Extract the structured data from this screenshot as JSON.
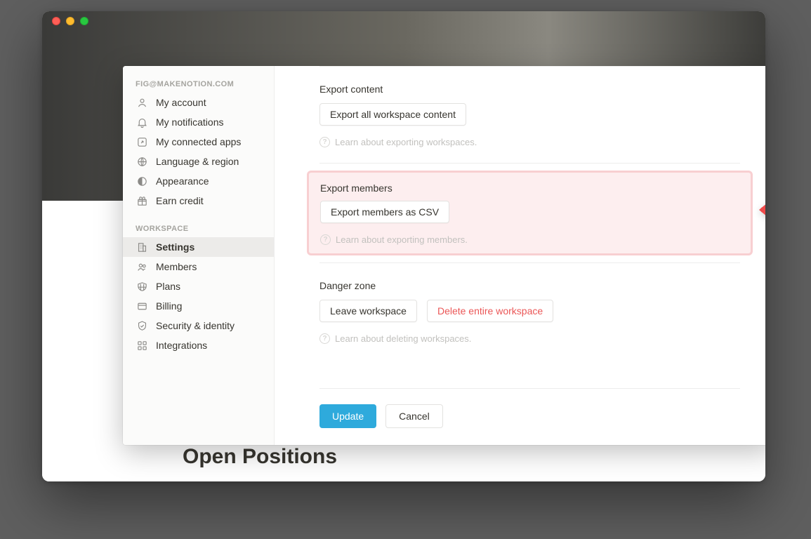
{
  "page": {
    "heading": "Open Positions"
  },
  "sidebar": {
    "email": "FIG@MAKENOTION.COM",
    "account_items": [
      {
        "label": "My account",
        "icon": "user-icon"
      },
      {
        "label": "My notifications",
        "icon": "bell-icon"
      },
      {
        "label": "My connected apps",
        "icon": "apps-icon"
      },
      {
        "label": "Language & region",
        "icon": "globe-icon"
      },
      {
        "label": "Appearance",
        "icon": "moon-icon"
      },
      {
        "label": "Earn credit",
        "icon": "gift-icon"
      }
    ],
    "workspace_label": "WORKSPACE",
    "workspace_items": [
      {
        "label": "Settings",
        "icon": "building-icon",
        "active": true
      },
      {
        "label": "Members",
        "icon": "people-icon"
      },
      {
        "label": "Plans",
        "icon": "plans-icon"
      },
      {
        "label": "Billing",
        "icon": "card-icon"
      },
      {
        "label": "Security & identity",
        "icon": "shield-icon"
      },
      {
        "label": "Integrations",
        "icon": "integrations-icon"
      }
    ]
  },
  "content": {
    "export_content": {
      "title": "Export content",
      "button": "Export all workspace content",
      "learn": "Learn about exporting workspaces."
    },
    "export_members": {
      "title": "Export members",
      "button": "Export members as CSV",
      "learn": "Learn about exporting members."
    },
    "danger": {
      "title": "Danger zone",
      "leave": "Leave workspace",
      "delete": "Delete entire workspace",
      "learn": "Learn about deleting workspaces."
    },
    "footer": {
      "update": "Update",
      "cancel": "Cancel"
    }
  }
}
